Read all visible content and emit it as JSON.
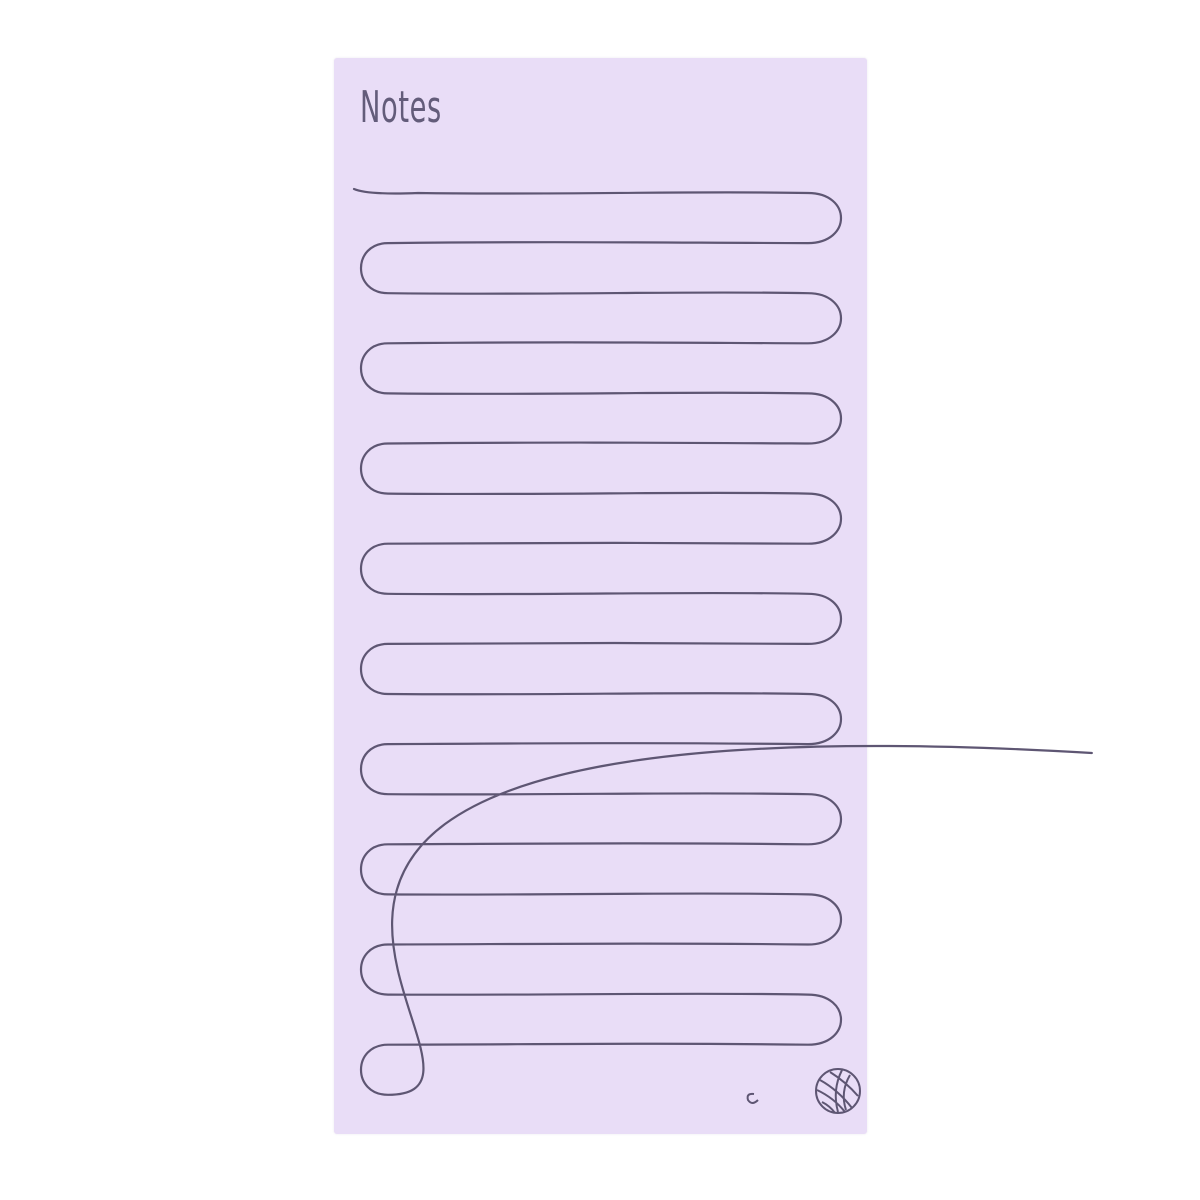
{
  "notepad": {
    "title": "Notes",
    "paper_color": "#e9ddf7",
    "ink_color": "#5e5673",
    "decoration": "yarn-ball-icon"
  }
}
